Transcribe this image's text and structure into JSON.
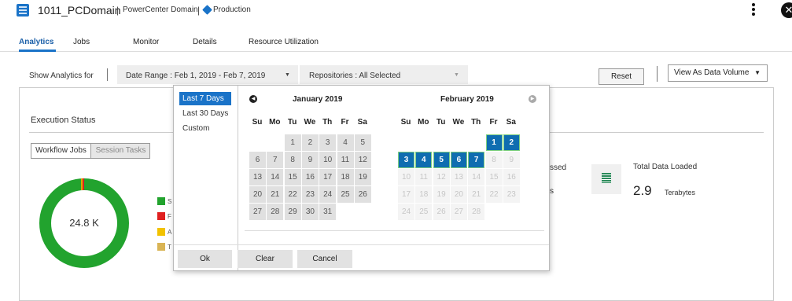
{
  "header": {
    "domain_name": "1011_PCDomain",
    "separator": "|",
    "domain_type": "PowerCenter Domain",
    "environment": "Production",
    "menu_icon": "kebab-icon",
    "close_icon": "close-icon"
  },
  "tabs": [
    {
      "label": "Analytics",
      "active": true
    },
    {
      "label": "Jobs",
      "active": false
    },
    {
      "label": "Monitor",
      "active": false
    },
    {
      "label": "Details",
      "active": false
    },
    {
      "label": "Resource Utilization",
      "active": false
    }
  ],
  "filter": {
    "show_label": "Show Analytics for",
    "date_range": "Date Range : Feb 1, 2019 - Feb 7, 2019",
    "repositories": "Repositories : All Selected",
    "reset_label": "Reset",
    "view_select": "View As Data Volume"
  },
  "execution": {
    "title": "Execution Status",
    "segment_on": "Workflow Jobs",
    "segment_off": "Session Tasks",
    "donut_label": "24.8 K",
    "legend": [
      {
        "text": "S",
        "color": "#22a32e"
      },
      {
        "text": "F",
        "color": "#e02020"
      },
      {
        "text": "A",
        "color": "#f2c200"
      },
      {
        "text": "T",
        "color": "#d9b455"
      }
    ],
    "partial_label_1": "ssed",
    "partial_label_2": "s"
  },
  "total_data": {
    "icon": "database-icon",
    "label": "Total Data Loaded",
    "value": "2.9",
    "unit": "Terabytes"
  },
  "picker": {
    "presets": [
      {
        "label": "Last 7 Days",
        "selected": true
      },
      {
        "label": "Last 30 Days",
        "selected": false
      },
      {
        "label": "Custom",
        "selected": false
      }
    ],
    "weekdays": [
      "Su",
      "Mo",
      "Tu",
      "We",
      "Th",
      "Fr",
      "Sa"
    ],
    "months": [
      {
        "title": "January 2019",
        "cells": [
          "",
          "",
          "1",
          "2",
          "3",
          "4",
          "5",
          "6",
          "7",
          "8",
          "9",
          "10",
          "11",
          "12",
          "13",
          "14",
          "15",
          "16",
          "17",
          "18",
          "19",
          "20",
          "21",
          "22",
          "23",
          "24",
          "25",
          "26",
          "27",
          "28",
          "29",
          "30",
          "31",
          "",
          ""
        ],
        "disabled": [],
        "selected": []
      },
      {
        "title": "February 2019",
        "cells": [
          "",
          "",
          "",
          "",
          "",
          "1",
          "2",
          "3",
          "4",
          "5",
          "6",
          "7",
          "8",
          "9",
          "10",
          "11",
          "12",
          "13",
          "14",
          "15",
          "16",
          "17",
          "18",
          "19",
          "20",
          "21",
          "22",
          "23",
          "24",
          "25",
          "26",
          "27",
          "28",
          "",
          ""
        ],
        "disabled": [
          "8",
          "9",
          "10",
          "11",
          "12",
          "13",
          "14",
          "15",
          "16",
          "17",
          "18",
          "19",
          "20",
          "21",
          "22",
          "23",
          "24",
          "25",
          "26",
          "27",
          "28"
        ],
        "selected": [
          "1",
          "2",
          "3",
          "4",
          "5",
          "6",
          "7"
        ]
      }
    ],
    "buttons": {
      "ok": "Ok",
      "clear": "Clear",
      "cancel": "Cancel"
    }
  }
}
